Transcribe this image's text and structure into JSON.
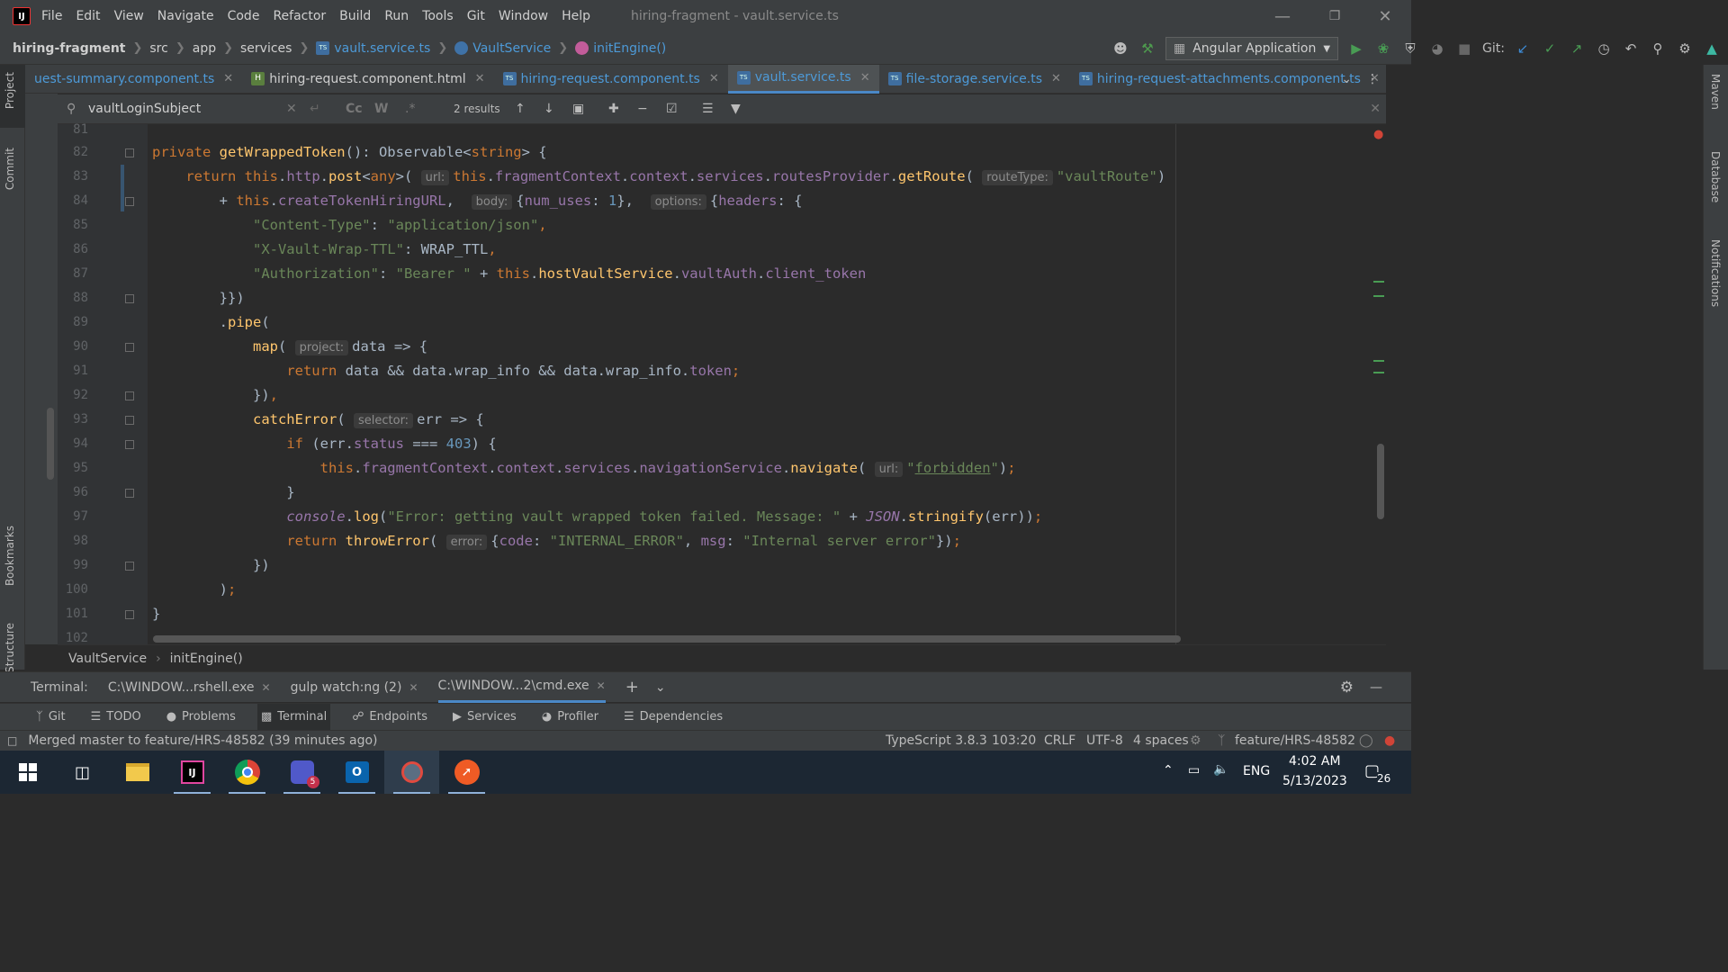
{
  "menubar": {
    "items": [
      "File",
      "Edit",
      "View",
      "Navigate",
      "Code",
      "Refactor",
      "Build",
      "Run",
      "Tools",
      "Git",
      "Window",
      "Help"
    ],
    "title": "hiring-fragment - vault.service.ts"
  },
  "navbar": {
    "crumbs": [
      "hiring-fragment",
      "src",
      "app",
      "services",
      "vault.service.ts",
      "VaultService",
      "initEngine()"
    ],
    "run_config": "Angular Application",
    "git_label": "Git:"
  },
  "left_tools": [
    "Project",
    "Commit",
    "Bookmarks",
    "Structure"
  ],
  "right_tools": [
    "Maven",
    "Database",
    "Notifications"
  ],
  "tabs": [
    {
      "label": "uest-summary.component.ts"
    },
    {
      "label": "hiring-request.component.html"
    },
    {
      "label": "hiring-request.component.ts"
    },
    {
      "label": "vault.service.ts"
    },
    {
      "label": "file-storage.service.ts"
    },
    {
      "label": "hiring-request-attachments.component.ts"
    }
  ],
  "find": {
    "query": "vaultLoginSubject",
    "results": "2 results",
    "opt_case": "Cc",
    "opt_word": "W",
    "opt_regex": ".*"
  },
  "line_numbers": [
    "81",
    "82",
    "83",
    "84",
    "85",
    "86",
    "87",
    "88",
    "89",
    "90",
    "91",
    "92",
    "93",
    "94",
    "95",
    "96",
    "97",
    "98",
    "99",
    "100",
    "101",
    "102"
  ],
  "breadcrumb": {
    "class": "VaultService",
    "method": "initEngine()"
  },
  "terminal": {
    "label": "Terminal:",
    "tabs": [
      "C:\\WINDOW...rshell.exe",
      "gulp watch:ng (2)",
      "C:\\WINDOW...2\\cmd.exe"
    ]
  },
  "tool_windows": [
    "Git",
    "TODO",
    "Problems",
    "Terminal",
    "Endpoints",
    "Services",
    "Profiler",
    "Dependencies"
  ],
  "status": {
    "message": "Merged master to feature/HRS-48582 (39 minutes ago)",
    "language": "TypeScript 3.8.3",
    "position": "103:20",
    "line_sep": "CRLF",
    "encoding": "UTF-8",
    "indent": "4 spaces",
    "branch": "feature/HRS-48582"
  },
  "taskbar": {
    "lang": "ENG",
    "time": "4:02 AM",
    "date": "5/13/2023",
    "notif_count": "26",
    "teams_badge": "5"
  },
  "colors": {
    "accent": "#4a88c7",
    "keyword": "#cc7832",
    "function": "#ffc66d",
    "string": "#6a8759",
    "number": "#6897bb",
    "property": "#9876aa"
  }
}
